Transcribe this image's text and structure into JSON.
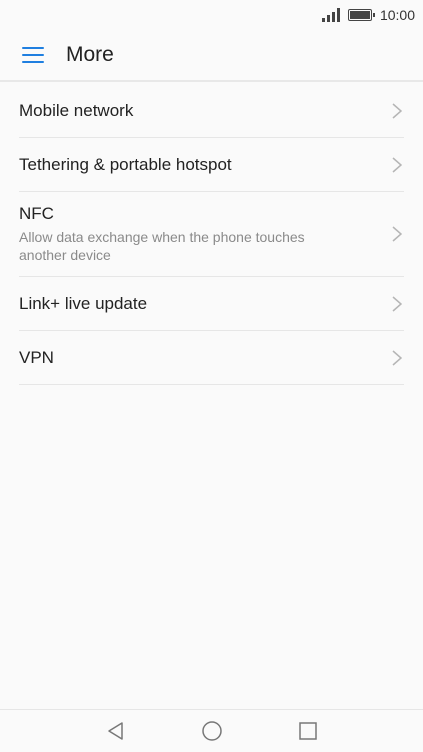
{
  "status_bar": {
    "time": "10:00",
    "icons": [
      "signal-icon",
      "battery-icon"
    ]
  },
  "header": {
    "title": "More",
    "menu_icon": "hamburger-menu-icon"
  },
  "list": {
    "items": [
      {
        "title": "Mobile network",
        "subtitle": ""
      },
      {
        "title": "Tethering & portable hotspot",
        "subtitle": ""
      },
      {
        "title": "NFC",
        "subtitle": "Allow data exchange when the phone touches another device"
      },
      {
        "title": "Link+ live update",
        "subtitle": ""
      },
      {
        "title": "VPN",
        "subtitle": ""
      }
    ],
    "chevron_icon": "chevron-right-icon"
  },
  "nav_bar": {
    "buttons": [
      "back-icon",
      "home-icon",
      "recents-icon"
    ]
  },
  "colors": {
    "accent": "#1f7fe0",
    "background": "#fafafa",
    "divider": "#e6e6e6",
    "subtitle": "#8a8a8a"
  }
}
